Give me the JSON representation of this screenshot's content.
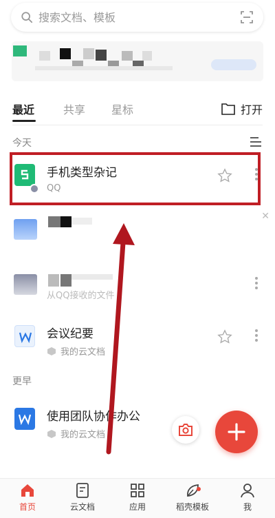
{
  "search": {
    "placeholder": "搜索文档、模板"
  },
  "tabs": [
    {
      "label": "最近",
      "active": true
    },
    {
      "label": "共享",
      "active": false
    },
    {
      "label": "星标",
      "active": false
    }
  ],
  "open_label": "打开",
  "sections": {
    "today": "今天",
    "earlier": "更早"
  },
  "files": [
    {
      "title": "手机类型杂记",
      "subtitle": "QQ",
      "icon": "notes-icon",
      "color": "#1fba75"
    },
    {
      "title": "",
      "subtitle": "",
      "icon": "blurred-icon"
    },
    {
      "title": "",
      "subtitle": "从QQ接收的文件",
      "icon": "blurred-icon"
    },
    {
      "title": "会议纪要",
      "subtitle": "我的云文档",
      "icon": "word-doc-icon",
      "color": "#2b78e4"
    },
    {
      "title": "使用团队协作办公",
      "subtitle": "我的云文档",
      "icon": "word-doc-icon",
      "color": "#2b78e4"
    }
  ],
  "bottom_nav": [
    {
      "label": "首页",
      "icon": "home-icon",
      "active": true
    },
    {
      "label": "云文档",
      "icon": "cloud-doc-icon",
      "active": false
    },
    {
      "label": "应用",
      "icon": "apps-grid-icon",
      "active": false
    },
    {
      "label": "稻壳模板",
      "icon": "template-leaf-icon",
      "active": false
    },
    {
      "label": "我",
      "icon": "profile-icon",
      "active": false
    }
  ],
  "colors": {
    "accent": "#e8473b",
    "annotation": "#c01e25",
    "doc_blue": "#2b78e4",
    "notes_green": "#1fba75"
  }
}
